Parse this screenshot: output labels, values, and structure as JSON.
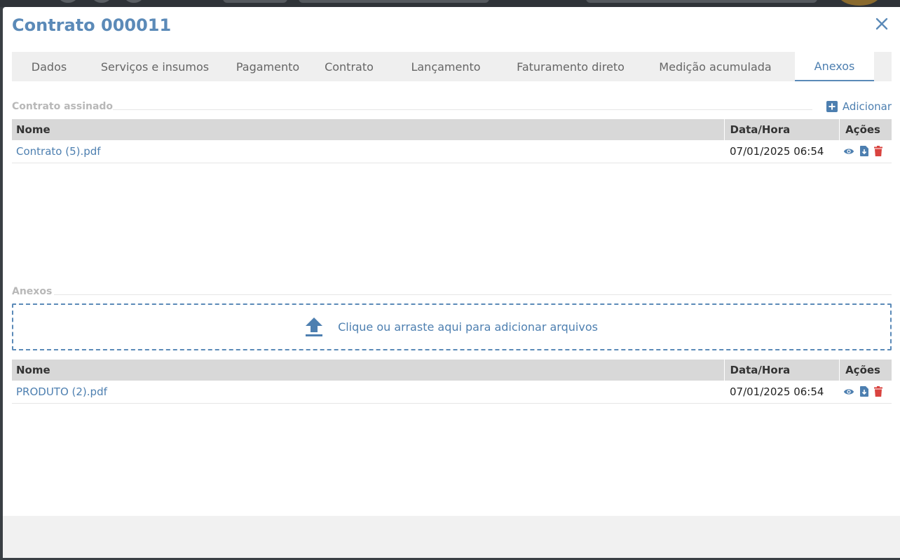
{
  "modal": {
    "title": "Contrato 000011"
  },
  "tabs": [
    {
      "label": "Dados"
    },
    {
      "label": "Serviços e insumos"
    },
    {
      "label": "Pagamento"
    },
    {
      "label": "Contrato"
    },
    {
      "label": "Lançamento"
    },
    {
      "label": "Faturamento direto"
    },
    {
      "label": "Medição acumulada"
    },
    {
      "label": "Anexos",
      "active": true
    }
  ],
  "signed_contract": {
    "section_title": "Contrato assinado",
    "add_label": "Adicionar",
    "columns": {
      "name": "Nome",
      "datetime": "Data/Hora",
      "actions": "Ações"
    },
    "rows": [
      {
        "name": "Contrato (5).pdf",
        "datetime": "07/01/2025 06:54"
      }
    ]
  },
  "attachments": {
    "section_title": "Anexos",
    "dropzone_text": "Clique ou arraste aqui para adicionar arquivos",
    "columns": {
      "name": "Nome",
      "datetime": "Data/Hora",
      "actions": "Ações"
    },
    "rows": [
      {
        "name": "PRODUTO (2).pdf",
        "datetime": "07/01/2025 06:54"
      }
    ]
  },
  "icons": {
    "close": "close-icon",
    "add": "plus-square-icon",
    "upload": "upload-icon",
    "view": "eye-icon",
    "download": "file-download-icon",
    "delete": "trash-icon"
  },
  "colors": {
    "accent": "#5b8ab8",
    "link": "#4d7fb0",
    "danger": "#d9433f",
    "header_bg": "#d8d8d8",
    "tabs_bg": "#efefef"
  }
}
